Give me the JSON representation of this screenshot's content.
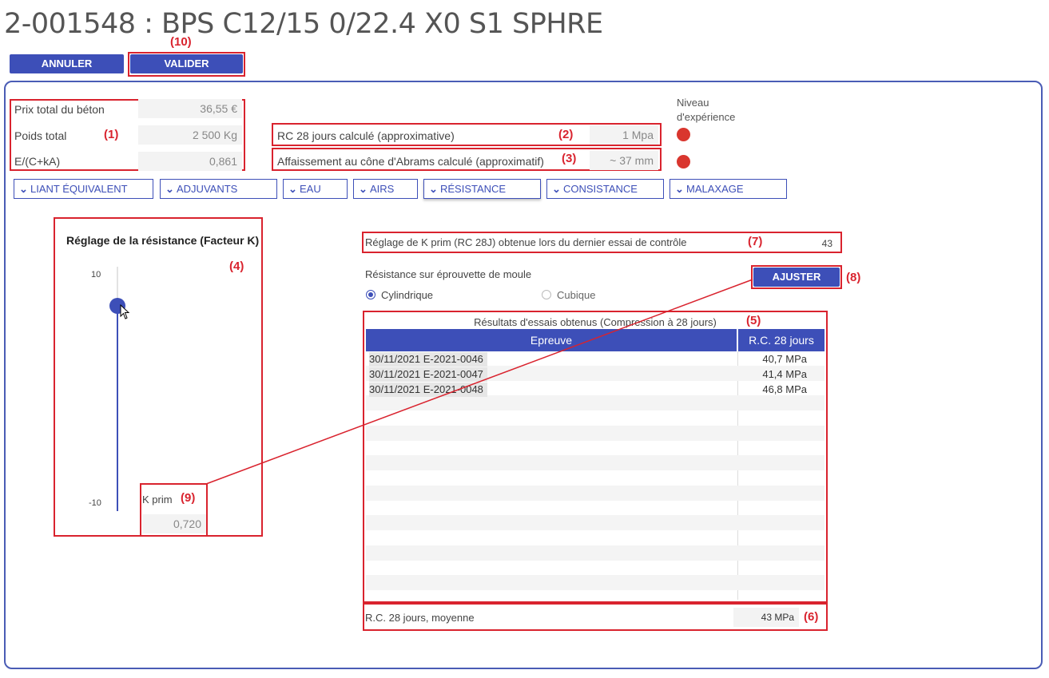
{
  "title": "2-001548 : BPS C12/15 0/22.4 X0 S1 SPHRE",
  "toolbar": {
    "cancel_label": "ANNULER",
    "validate_label": "VALIDER"
  },
  "annotations": {
    "a1": "(1)",
    "a2": "(2)",
    "a3": "(3)",
    "a4": "(4)",
    "a5": "(5)",
    "a6": "(6)",
    "a7": "(7)",
    "a8": "(8)",
    "a9": "(9)",
    "a10": "(10)"
  },
  "summary": {
    "price_label": "Prix total du béton",
    "price_value": "36,55 €",
    "weight_label": "Poids total",
    "weight_value": "2 500 Kg",
    "ratio_label": "E/(C+kA)",
    "ratio_value": "0,861"
  },
  "calc": {
    "rc28_label": "RC 28 jours calculé (approximative)",
    "rc28_value": "1 Mpa",
    "slump_label": "Affaissement au cône d'Abrams calculé (approximatif)",
    "slump_value": "~ 37 mm"
  },
  "experience": {
    "label_line1": "Niveau",
    "label_line2": "d'expérience",
    "color": "#d9362e"
  },
  "tabs": [
    {
      "label": "LIANT ÉQUIVALENT"
    },
    {
      "label": "ADJUVANTS"
    },
    {
      "label": "EAU"
    },
    {
      "label": "AIRS"
    },
    {
      "label": "RÉSISTANCE"
    },
    {
      "label": "CONSISTANCE"
    },
    {
      "label": "MALAXAGE"
    }
  ],
  "active_tab": "RÉSISTANCE",
  "resistance": {
    "title": "Réglage de la résistance (Facteur K)",
    "max_label": "10",
    "min_label": "-10",
    "slider_value": 6.8,
    "slider_min": -10,
    "slider_max": 10,
    "kprim_label": "K prim",
    "kprim_value": "0,720"
  },
  "control": {
    "kprim_test_label": "Réglage de K prim (RC 28J) obtenue lors du dernier essai de contrôle",
    "kprim_test_value": "43",
    "adjust_label": "AJUSTER",
    "mold_label": "Résistance sur éprouvette de moule",
    "mold_options": [
      "Cylindrique",
      "Cubique"
    ],
    "mold_selected": "Cylindrique"
  },
  "results": {
    "caption": "Résultats d'essais obtenus (Compression à 28 jours)",
    "columns": [
      "Epreuve",
      "R.C. 28 jours"
    ],
    "rows": [
      {
        "date": "30/11/2021",
        "id": "E-2021-0046",
        "rc": "40,7 MPa"
      },
      {
        "date": "30/11/2021",
        "id": "E-2021-0047",
        "rc": "41,4 MPa"
      },
      {
        "date": "30/11/2021",
        "id": "E-2021-0048",
        "rc": "46,8 MPa"
      }
    ],
    "avg_label": "R.C. 28 jours, moyenne",
    "avg_value": "43 MPa"
  },
  "colors": {
    "accent": "#3d4fb8",
    "annotation": "#d9232e"
  }
}
